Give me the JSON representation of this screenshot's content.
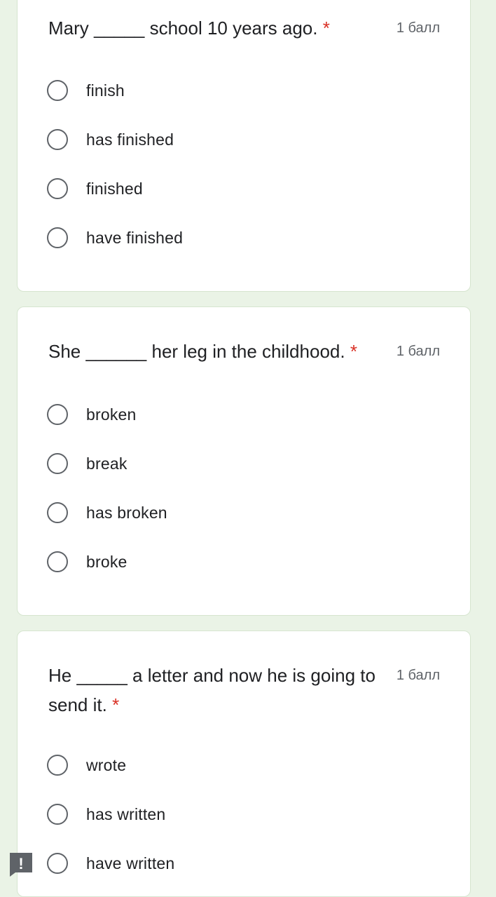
{
  "questions": [
    {
      "title_before": "Mary",
      "blank": "_____",
      "title_after": "school 10 years ago.",
      "required_mark": "*",
      "points": "1 балл",
      "options": [
        "finish",
        "has finished",
        "finished",
        "have finished"
      ]
    },
    {
      "title_before": "She",
      "blank": "______",
      "title_after": "her leg in the childhood.",
      "required_mark": "*",
      "points": "1 балл",
      "options": [
        "broken",
        "break",
        "has broken",
        "broke"
      ]
    },
    {
      "title_before": "He",
      "blank": "_____",
      "title_after": "a letter and now he is going to send it.",
      "required_mark": "*",
      "points": "1 балл",
      "options": [
        "wrote",
        "has written",
        "have written"
      ]
    }
  ],
  "report_button": {
    "icon": "exclamation-icon",
    "symbol": "!",
    "color": "#5f6368"
  },
  "colors": {
    "background": "#eaf3e6",
    "card": "#ffffff",
    "required": "#d93025",
    "text": "#202124",
    "secondary_text": "#5f6368"
  }
}
